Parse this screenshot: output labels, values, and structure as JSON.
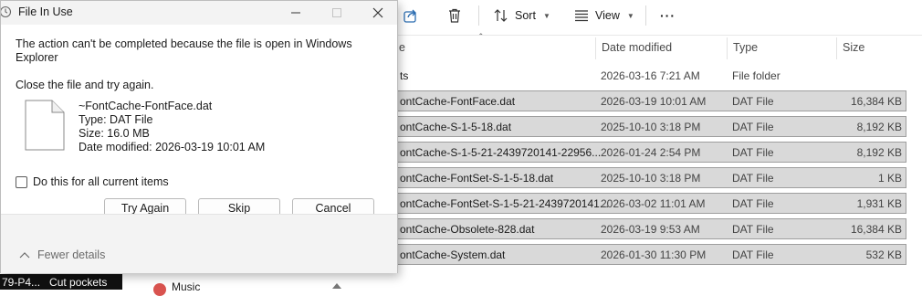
{
  "explorer": {
    "toolbar": {
      "sort_label": "Sort",
      "view_label": "View",
      "more_label": "···"
    },
    "columns": {
      "name": "e",
      "date": "Date modified",
      "type": "Type",
      "size": "Size"
    },
    "rows": [
      {
        "name": "ts",
        "date": "2026-03-16 7:21 AM",
        "type": "File folder",
        "size": ""
      },
      {
        "name": "ontCache-FontFace.dat",
        "date": "2026-03-19 10:01 AM",
        "type": "DAT File",
        "size": "16,384 KB"
      },
      {
        "name": "ontCache-S-1-5-18.dat",
        "date": "2025-10-10 3:18 PM",
        "type": "DAT File",
        "size": "8,192 KB"
      },
      {
        "name": "ontCache-S-1-5-21-2439720141-22956...",
        "date": "2026-01-24 2:54 PM",
        "type": "DAT File",
        "size": "8,192 KB"
      },
      {
        "name": "ontCache-FontSet-S-1-5-18.dat",
        "date": "2025-10-10 3:18 PM",
        "type": "DAT File",
        "size": "1 KB"
      },
      {
        "name": "ontCache-FontSet-S-1-5-21-2439720141...",
        "date": "2026-03-02 11:01 AM",
        "type": "DAT File",
        "size": "1,931 KB"
      },
      {
        "name": "ontCache-Obsolete-828.dat",
        "date": "2026-03-19 9:53 AM",
        "type": "DAT File",
        "size": "16,384 KB"
      },
      {
        "name": "ontCache-System.dat",
        "date": "2026-01-30 11:30 PM",
        "type": "DAT File",
        "size": "532 KB"
      }
    ],
    "nav_music": "Music",
    "tooltip": {
      "left": "79-P4...",
      "right": "Cut pockets"
    }
  },
  "dialog": {
    "title": "File In Use",
    "message": "The action can't be completed because the file is open in Windows Explorer",
    "instruction": "Close the file and try again.",
    "file": {
      "name": "~FontCache-FontFace.dat",
      "type": "Type: DAT File",
      "size": "Size: 16.0 MB",
      "modified": "Date modified: 2026-03-19 10:01 AM"
    },
    "checkbox_label": "Do this for all current items",
    "checkbox_checked": false,
    "buttons": {
      "try_again": "Try Again",
      "skip": "Skip",
      "cancel": "Cancel"
    },
    "fewer_details": "Fewer details"
  }
}
